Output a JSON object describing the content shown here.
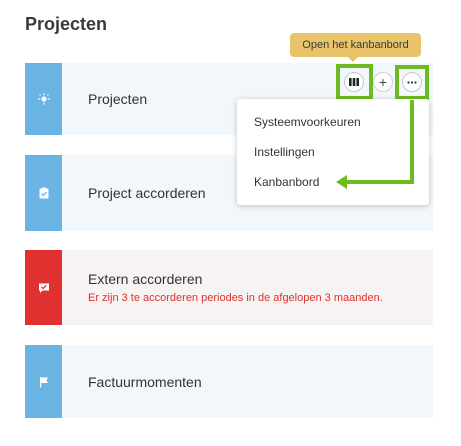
{
  "page": {
    "title": "Projecten"
  },
  "tooltip": {
    "text": "Open het kanbanbord"
  },
  "cards": [
    {
      "label": "Projecten",
      "icon": "lightbulb-icon",
      "color": "#6ab4e4"
    },
    {
      "label": "Project accorderen",
      "icon": "clipboard-check-icon",
      "color": "#6ab4e4"
    },
    {
      "label": "Extern accorderen",
      "sub": "Er zijn 3 te accorderen periodes in de afgelopen 3 maanden.",
      "icon": "chat-check-icon",
      "color": "#e03030"
    },
    {
      "label": "Factuurmomenten",
      "icon": "flag-icon",
      "color": "#6ab4e4"
    }
  ],
  "actions": {
    "kanban_icon": "kanban-icon",
    "plus_label": "+",
    "more_icon": "more-dots-icon"
  },
  "menu": {
    "items": [
      "Systeemvoorkeuren",
      "Instellingen",
      "Kanbanbord"
    ]
  },
  "colors": {
    "accent_blue": "#6ab4e4",
    "alert_red": "#e03030",
    "highlight_green": "#6cbb1f",
    "tooltip_yellow": "#e8c36a"
  }
}
